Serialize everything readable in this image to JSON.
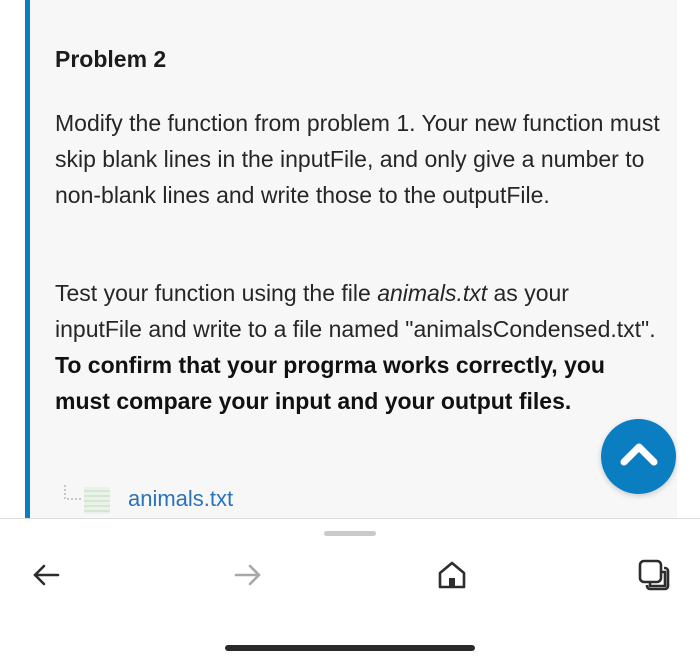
{
  "problem": {
    "title": "Problem 2",
    "paragraph1": "Modify the function from problem 1. Your new function must skip blank lines in the inputFile, and only give a number to non-blank lines and write those to the outputFile.",
    "paragraph2_part1": "Test your function using the file ",
    "paragraph2_filename": "animals.txt",
    "paragraph2_part2": " as your inputFile and write to a file named \"animalsCondensed.txt\". ",
    "paragraph2_bold": "To confirm that your progrma works correctly, you must compare your input and your output files."
  },
  "attachment": {
    "filename": "animals.txt",
    "icon": "text-file-icon"
  },
  "scroll_top": {
    "icon": "chevron-up-icon"
  },
  "toolbar": {
    "back_icon": "arrow-left-icon",
    "forward_icon": "arrow-right-icon",
    "home_icon": "home-icon",
    "tabs_icon": "tabs-icon"
  },
  "colors": {
    "accent": "#0b7ec2",
    "link": "#2a73b8",
    "card_background": "#f7f7f8"
  }
}
